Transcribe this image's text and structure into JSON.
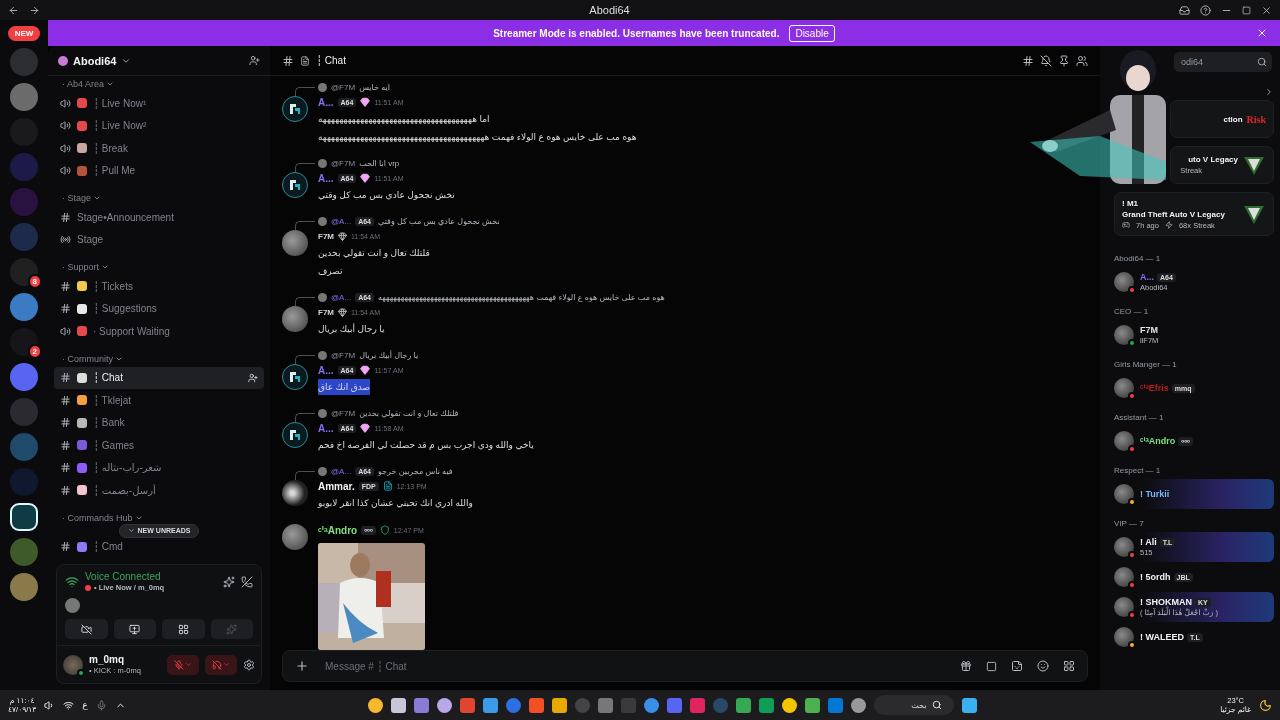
{
  "window": {
    "title": "Abodi64"
  },
  "banner": {
    "text": "Streamer Mode is enabled. Usernames have been truncated.",
    "button": "Disable"
  },
  "rail": {
    "new_badge": "NEW",
    "servers": [
      {
        "color": "#2b2d31",
        "selected": false
      },
      {
        "color": "#6b6b6b",
        "selected": false
      },
      {
        "color": "#1a1a1c",
        "selected": false
      },
      {
        "color": "#1d1a4a",
        "selected": false
      },
      {
        "color": "#2a1240",
        "selected": false
      },
      {
        "color": "#1e2a4a",
        "selected": false
      },
      {
        "color": "#202020",
        "selected": false,
        "badge": "8"
      },
      {
        "color": "#3b7bc4",
        "selected": false
      },
      {
        "color": "#15151a",
        "selected": false,
        "badge": "2"
      },
      {
        "color": "#5865f2",
        "selected": false
      },
      {
        "color": "#2a2a30",
        "selected": false
      },
      {
        "color": "#1f4a6a",
        "selected": false
      },
      {
        "color": "#101830",
        "selected": false
      },
      {
        "color": "#0e3b44",
        "selected": true
      },
      {
        "color": "#3f5a2a",
        "selected": false
      },
      {
        "color": "#8a7a4a",
        "selected": false
      }
    ]
  },
  "server": {
    "name": "Abodi64"
  },
  "categories": [
    {
      "name": "· Ab4 Area",
      "channels": [
        {
          "kind": "voice",
          "label": "┆ Live Now¹",
          "color": "#e5484d",
          "selected": false
        },
        {
          "kind": "voice",
          "label": "┆ Live Now²",
          "color": "#e5484d",
          "selected": false
        },
        {
          "kind": "voice",
          "label": "┆ Break",
          "color": "#c9a6a0",
          "selected": false
        },
        {
          "kind": "voice",
          "label": "┆ Pull Me",
          "color": "#b5533c",
          "selected": false
        }
      ]
    },
    {
      "name": "· Stage",
      "channels": [
        {
          "kind": "text",
          "label": "Stage•Announcement",
          "selected": false
        },
        {
          "kind": "stage",
          "label": "Stage",
          "selected": false
        }
      ]
    },
    {
      "name": "· Support",
      "channels": [
        {
          "kind": "text",
          "label": "┆ Tickets",
          "color": "#f2c94c",
          "selected": false
        },
        {
          "kind": "text",
          "label": "┆ Suggestions",
          "color": "#e8e8e8",
          "selected": false
        },
        {
          "kind": "voice",
          "label": "· Support Waiting",
          "color": "#e5484d",
          "selected": false
        }
      ]
    },
    {
      "name": "· Community",
      "channels": [
        {
          "kind": "text",
          "label": "┆ Chat",
          "color": "#dcdcdc",
          "selected": true
        },
        {
          "kind": "text",
          "label": "┆ Tklejat",
          "color": "#f59e42",
          "selected": false
        },
        {
          "kind": "text",
          "label": "┆ Bank",
          "color": "#b8b8b8",
          "selected": false
        },
        {
          "kind": "text",
          "label": "┆ Games",
          "color": "#7c5cd6",
          "selected": false
        },
        {
          "kind": "text",
          "label": "┆ شعر-راب-نثاله",
          "color": "#8b5cf6",
          "selected": false
        },
        {
          "kind": "text",
          "label": "┆ أرسل-بصمت",
          "color": "#f0c4d0",
          "selected": false
        }
      ]
    },
    {
      "name": "· Commands Hub",
      "channels": [
        {
          "kind": "text",
          "label": "┆ Cmd",
          "color": "#8b7cf6",
          "selected": false
        }
      ]
    }
  ],
  "new_unreads": "NEW UNREADS",
  "voice": {
    "status": "Voice Connected",
    "channel": "• Live Now / m_0mq"
  },
  "user": {
    "name": "m_0mq",
    "status": "• KICK : m-0mq"
  },
  "chat": {
    "channel": "┆ Chat",
    "search": {
      "placeholder": "odi64"
    },
    "composer": {
      "placeholder": "Message # ┆ Chat"
    }
  },
  "messages": [
    {
      "kind": "logo",
      "reply": {
        "mention": "@F7M",
        "text": "ايه خايس"
      },
      "author": "A...",
      "color": "#8b6cf7",
      "tag": "A64",
      "role": {
        "kind": "gem"
      },
      "time": "11:51 AM",
      "lines": [
        {
          "text": "اما هههههههههههههههههههههههههههههههههههههه",
          "selected": false
        },
        {
          "text": "هوه مب على خايس هوه ع الولاء فهمت ههههههههههههههههههههههههههههههههههههههههه",
          "selected": false
        }
      ]
    },
    {
      "kind": "logo",
      "reply": {
        "mention": "@F7M",
        "text": "انا الحب vrp"
      },
      "author": "A...",
      "color": "#8b6cf7",
      "tag": "A64",
      "role": {
        "kind": "gem"
      },
      "time": "11:51 AM",
      "lines": [
        {
          "text": "نخش نجحول عادي بس مب كل وقتي",
          "selected": false
        }
      ]
    },
    {
      "reply": {
        "mention": "@A...",
        "tag": "A64",
        "text": "نخش نجحول عادي بس مب كل وقتي"
      },
      "author": "F7M",
      "color": "#d4d4d8",
      "role": {
        "kind": "white-gem"
      },
      "time": "11:54 AM",
      "lines": [
        {
          "text": "قلتلك تعال و انت تقولي بحدين",
          "selected": false
        },
        {
          "text": "تصرف",
          "selected": false
        }
      ]
    },
    {
      "reply": {
        "mention": "@A...",
        "tag": "A64",
        "text": "هوه مب على خايس هوه ع الولاء فهمت هههههههههههههههههههههههههههههههههههههههههه"
      },
      "author": "F7M",
      "color": "#d4d4d8",
      "role": {
        "kind": "white-gem"
      },
      "time": "11:54 AM",
      "lines": [
        {
          "text": "يا رجال أبيك بريال",
          "selected": false
        }
      ]
    },
    {
      "kind": "logo",
      "reply": {
        "mention": "@F7M",
        "text": "يا رجال أبيك بريال"
      },
      "author": "A...",
      "color": "#8b6cf7",
      "tag": "A64",
      "role": {
        "kind": "gem"
      },
      "time": "11:57 AM",
      "lines": [
        {
          "text": "صدق انك عاق",
          "selected": true
        }
      ]
    },
    {
      "kind": "logo",
      "reply": {
        "mention": "@F7M",
        "text": "قلتلك تعال و انت تقولي بحدين"
      },
      "author": "A...",
      "color": "#8b6cf7",
      "tag": "A64",
      "role": {
        "kind": "gem"
      },
      "time": "11:58 AM",
      "lines": [
        {
          "text": "ياخي والله ودي اجرب بس م قد حصلت لي الفرصه اخ فحم",
          "selected": false
        }
      ]
    },
    {
      "kind": "dark",
      "reply": {
        "mention": "@A...",
        "tag": "A64",
        "text": "فيه ناس مجربين خرجو"
      },
      "author": "Ammar.",
      "color": "#f2f3f5",
      "tag": "FDP",
      "role": {
        "kind": "logo"
      },
      "time": "12:13 PM",
      "lines": [
        {
          "text": "والله ادري انك تحبني عشان كذا انقر لابوبو",
          "selected": false
        }
      ]
    },
    {
      "author": "ᶜⁱᵃAndro",
      "color": "#7ee07e",
      "tag": "ᵒᵒᵒ",
      "role": {
        "kind": "shield"
      },
      "time": "12:47 PM"
    }
  ],
  "members": {
    "activities": [
      {
        "title": "ction",
        "logo": "Risk"
      },
      {
        "title": "uto V Legacy",
        "subtitle": "Streak"
      },
      {
        "user": "! M1",
        "title": "Grand Theft Auto V Legacy",
        "time": "7h ago",
        "streak": "68x Streak"
      }
    ],
    "groups": [
      {
        "name": "Abodi64 — 1",
        "members": [
          {
            "name": "A...",
            "color": "#8b6cf7",
            "tag": "A64",
            "sub": "Abodi64",
            "status": {
              "kind": "dnd"
            },
            "nameplate": false
          }
        ]
      },
      {
        "name": "CEO — 1",
        "members": [
          {
            "name": "F7M",
            "color": "#e4e4e7",
            "sub": "llF7M",
            "status": {
              "kind": "online"
            },
            "nameplate": false
          }
        ]
      },
      {
        "name": "Girls Manger — 1",
        "members": [
          {
            "name": "ᶜⁱᵃEfris",
            "color": "#b91c1c",
            "tag": "mmq",
            "status": {
              "kind": "dnd"
            },
            "nameplate": false
          }
        ]
      },
      {
        "name": "Assistant — 1",
        "members": [
          {
            "name": "ᶜⁱᵃAndro",
            "color": "#7ee07e",
            "tag": "ᵒᵒᵒ",
            "status": {
              "kind": "dnd"
            },
            "nameplate": false
          }
        ]
      },
      {
        "name": "Respect — 1",
        "members": [
          {
            "name": "! Turkii",
            "color": "#7ab8f5",
            "status": {
              "kind": "idle"
            },
            "nameplate": true
          }
        ]
      },
      {
        "name": "VIP — 7",
        "members": [
          {
            "name": "! Ali",
            "color": "#f2f3f5",
            "tag": "T.L",
            "sub": "515",
            "status": {
              "kind": "dnd"
            },
            "nameplate": true
          },
          {
            "name": "! 5ordh",
            "color": "#f2f3f5",
            "tag": "JBL",
            "status": {
              "kind": "dnd"
            },
            "nameplate": false
          },
          {
            "name": "! SHOKMAN",
            "color": "#f2f3f5",
            "tag": "KY",
            "sub": "( رَبِّ اجْعَلْ هَٰذَا الْبَلَدَ آمِنًا )",
            "status": {
              "kind": "dnd"
            },
            "nameplate": true
          },
          {
            "name": "! WALEED",
            "color": "#f2f3f5",
            "tag": "T.L",
            "status": {
              "kind": "idle"
            },
            "nameplate": false
          }
        ]
      }
    ]
  },
  "taskbar": {
    "time": "١١:٠٤ م",
    "date": "٤٧/٠٩/١٣",
    "language": "ع",
    "search": {
      "placeholder": "بحث"
    },
    "weather": {
      "temp": "23°C",
      "text": "غائم جزئيا"
    }
  }
}
